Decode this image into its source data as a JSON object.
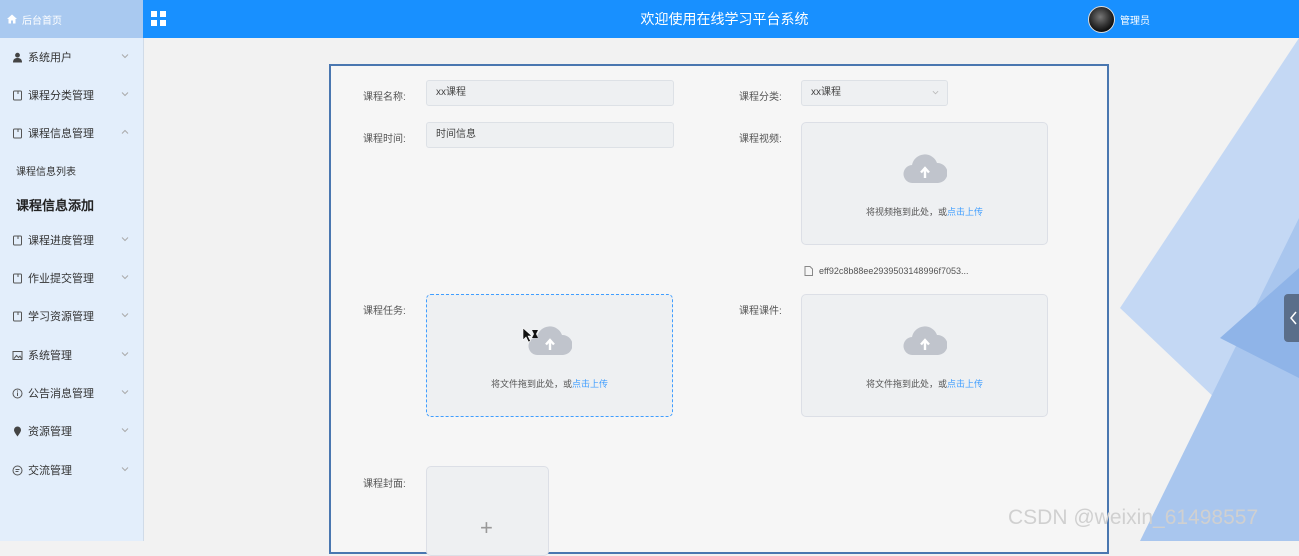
{
  "header": {
    "brand_label": "后台首页",
    "title": "欢迎使用在线学习平台系统",
    "user_label": "管理员"
  },
  "sidebar": {
    "items": [
      {
        "label": "系统用户",
        "icon": "user-icon",
        "expanded": false
      },
      {
        "label": "课程分类管理",
        "icon": "tablet-icon",
        "expanded": false
      },
      {
        "label": "课程信息管理",
        "icon": "tablet-icon",
        "expanded": true
      },
      {
        "label": "课程进度管理",
        "icon": "tablet-icon",
        "expanded": false
      },
      {
        "label": "作业提交管理",
        "icon": "tablet-icon",
        "expanded": false
      },
      {
        "label": "学习资源管理",
        "icon": "tablet-icon",
        "expanded": false
      },
      {
        "label": "系统管理",
        "icon": "picture-icon",
        "expanded": false
      },
      {
        "label": "公告消息管理",
        "icon": "info-icon",
        "expanded": false
      },
      {
        "label": "资源管理",
        "icon": "location-icon",
        "expanded": false
      },
      {
        "label": "交流管理",
        "icon": "chat-icon",
        "expanded": false
      }
    ],
    "subitems": [
      {
        "label": "课程信息列表",
        "active": false
      },
      {
        "label": "课程信息添加",
        "active": true
      }
    ]
  },
  "form": {
    "name": {
      "label": "课程名称:",
      "value": "xx课程"
    },
    "category": {
      "label": "课程分类:",
      "value": "xx课程"
    },
    "time": {
      "label": "课程时间:",
      "value": "时间信息"
    },
    "video": {
      "label": "课程视频:",
      "drop_text": "将视频拖到此处，或",
      "link_text": "点击上传",
      "file_name": "eff92c8b88ee2939503148996f7053..."
    },
    "task": {
      "label": "课程任务:",
      "drop_text": "将文件拖到此处，或",
      "link_text": "点击上传"
    },
    "courseware": {
      "label": "课程课件:",
      "drop_text": "将文件拖到此处，或",
      "link_text": "点击上传"
    },
    "cover": {
      "label": "课程封面:",
      "plus": "+"
    }
  },
  "watermark": "CSDN @weixin_61498557",
  "colors": {
    "header_blue": "#1890ff",
    "sidebar_bg": "#e3eefb",
    "link_blue": "#409eff",
    "panel_border": "#4a77b0"
  }
}
